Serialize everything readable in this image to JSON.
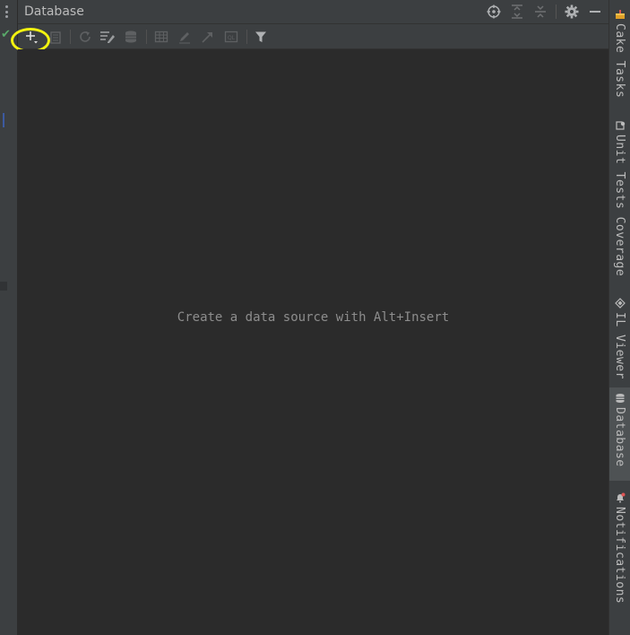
{
  "panel": {
    "title": "Database",
    "empty_message": "Create a data source with Alt+Insert"
  },
  "title_icons": [
    "crosshair-icon",
    "expand-all-icon",
    "collapse-all-icon",
    "gear-icon",
    "minimize-icon"
  ],
  "toolbar_icons": [
    "add-icon",
    "duplicate-icon",
    "refresh-icon",
    "edit-datasource-icon",
    "schema-icon",
    "table-icon",
    "edit-icon",
    "jump-icon",
    "console-icon",
    "filter-icon"
  ],
  "right_tabs": [
    {
      "label": "Cake Tasks",
      "icon": "cake-icon",
      "active": false
    },
    {
      "label": "Unit Tests Coverage",
      "icon": "coverage-icon",
      "active": false
    },
    {
      "label": "IL Viewer",
      "icon": "il-viewer-icon",
      "active": false
    },
    {
      "label": "Database",
      "icon": "database-icon",
      "active": true
    },
    {
      "label": "Notifications",
      "icon": "bell-icon",
      "active": false
    }
  ],
  "colors": {
    "background": "#2b2b2b",
    "panel_chrome": "#3c3f41",
    "highlight": "#f2f210",
    "text": "#bbbbbb",
    "muted_text": "#8d8d8d"
  }
}
